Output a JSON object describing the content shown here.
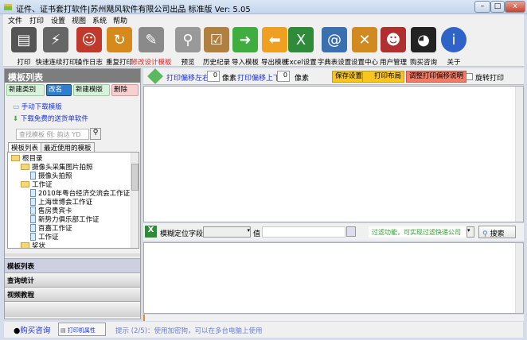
{
  "window": {
    "title": "证件、证书套打软件|苏州飓风软件有限公司出品 标准版  Ver: 5.05",
    "minimize": "–",
    "maximize": "□",
    "close": "x"
  },
  "menu": [
    "文件",
    "打印",
    "设置",
    "视图",
    "系统",
    "帮助"
  ],
  "toolbar": [
    {
      "label": "打印",
      "icon": "printer-icon",
      "color": "#555"
    },
    {
      "label": "快速连续打印",
      "icon": "fast-print-icon",
      "color": "#666"
    },
    {
      "label": "操作日志",
      "icon": "log-icon",
      "color": "#c0392b"
    },
    {
      "label": "重复打印",
      "icon": "reprint-icon",
      "color": "#d68a1c"
    },
    {
      "label": "修改设计模板",
      "icon": "design-icon",
      "color": "#8a8a8a",
      "highlight": true
    },
    {
      "label": "预览",
      "icon": "preview-icon",
      "color": "#999"
    },
    {
      "label": "历史纪录",
      "icon": "history-icon",
      "color": "#b08040"
    },
    {
      "label": "导入模板",
      "icon": "import-icon",
      "color": "#3fae3f"
    },
    {
      "label": "导出模板",
      "icon": "export-icon",
      "color": "#f0a020"
    },
    {
      "label": "Excel设置",
      "icon": "excel-icon",
      "color": "#2e8b3a"
    },
    {
      "label": "字典表设置",
      "icon": "dictionary-icon",
      "color": "#3a6fb0"
    },
    {
      "label": "设置中心",
      "icon": "settings-icon",
      "color": "#d08a20"
    },
    {
      "label": "用户管理",
      "icon": "users-icon",
      "color": "#b03030"
    },
    {
      "label": "购买咨询",
      "icon": "qq-icon",
      "color": "#222"
    },
    {
      "label": "关于",
      "icon": "info-icon",
      "color": "#2f63c8"
    }
  ],
  "left": {
    "header": "模板列表",
    "buttons": [
      "新建类别",
      "改名",
      "新建模版",
      "删除"
    ],
    "links": [
      "手动下载模版",
      "下载免费的送货单软件"
    ],
    "search_placeholder": "查找模板 例: 韵达 YD",
    "tabs": [
      "模板列表",
      "最近使用的模板"
    ],
    "tree": [
      {
        "label": "根目录",
        "type": "folder",
        "level": 0
      },
      {
        "label": "摄像头采集图片拍照",
        "type": "folder",
        "level": 1
      },
      {
        "label": "摄像头拍照",
        "type": "doc",
        "level": 2
      },
      {
        "label": "工作证",
        "type": "folder",
        "level": 1
      },
      {
        "label": "2010年粤台经济交流会工作证",
        "type": "doc",
        "level": 2
      },
      {
        "label": "上海世博会工作证",
        "type": "doc",
        "level": 2
      },
      {
        "label": "售房贵宾卡",
        "type": "doc",
        "level": 2
      },
      {
        "label": "新势力俱乐部工作证",
        "type": "doc",
        "level": 2
      },
      {
        "label": "百嘉工作证",
        "type": "doc",
        "level": 2
      },
      {
        "label": "工作证",
        "type": "doc",
        "level": 2
      },
      {
        "label": "奖状",
        "type": "folder",
        "level": 1
      }
    ],
    "accordion": [
      "模板列表",
      "查询统计",
      "视频教程"
    ]
  },
  "offset": {
    "lr_label": "打印偏移左右",
    "lr_value": "0",
    "unit": "像素",
    "ud_label": "打印偏移上下",
    "ud_value": "0",
    "unit2": "像素",
    "save": "保存设置",
    "layout": "打印布局",
    "help": "调整打印偏移说明",
    "rotate": "旋转打印"
  },
  "filter": {
    "field_label": "模糊定位字段",
    "value_label": "值",
    "hint": "过滤功能，可实现过滤快递公司",
    "search": "搜索"
  },
  "status": {
    "buy": "购买咨询",
    "printer": "打印机属性",
    "tip": "提示 (2/5)：使用加密狗，可以在多台电脑上使用"
  }
}
